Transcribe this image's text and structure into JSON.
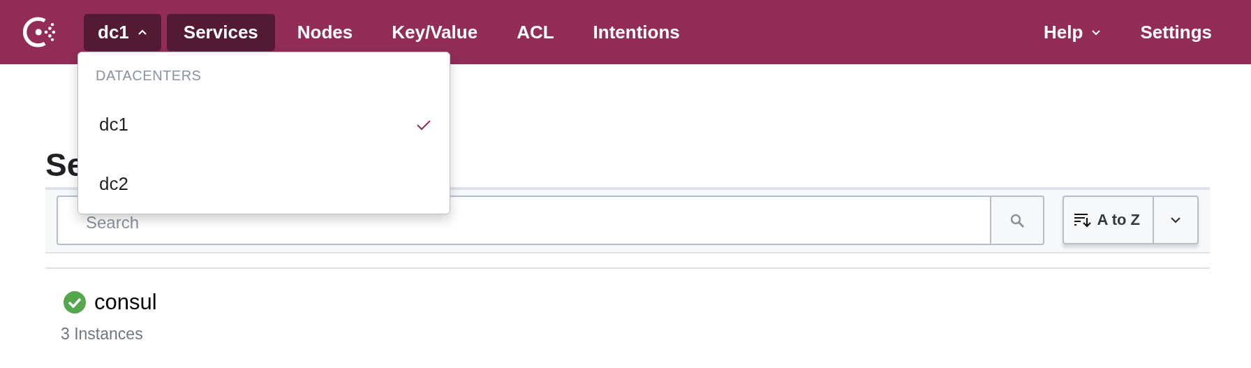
{
  "nav": {
    "datacenter": {
      "label": "dc1",
      "expanded": true
    },
    "items": [
      {
        "label": "Services",
        "selected": true
      },
      {
        "label": "Nodes",
        "selected": false
      },
      {
        "label": "Key/Value",
        "selected": false
      },
      {
        "label": "ACL",
        "selected": false
      },
      {
        "label": "Intentions",
        "selected": false
      }
    ],
    "help": "Help",
    "settings": "Settings"
  },
  "dropdown": {
    "heading": "DATACENTERS",
    "items": [
      {
        "label": "dc1",
        "selected": true
      },
      {
        "label": "dc2",
        "selected": false
      }
    ]
  },
  "page_title": "Se",
  "search": {
    "placeholder": "Search"
  },
  "sort": {
    "label": "A to Z"
  },
  "services": [
    {
      "name": "consul",
      "healthy": true,
      "instances": "3 Instances"
    }
  ]
}
